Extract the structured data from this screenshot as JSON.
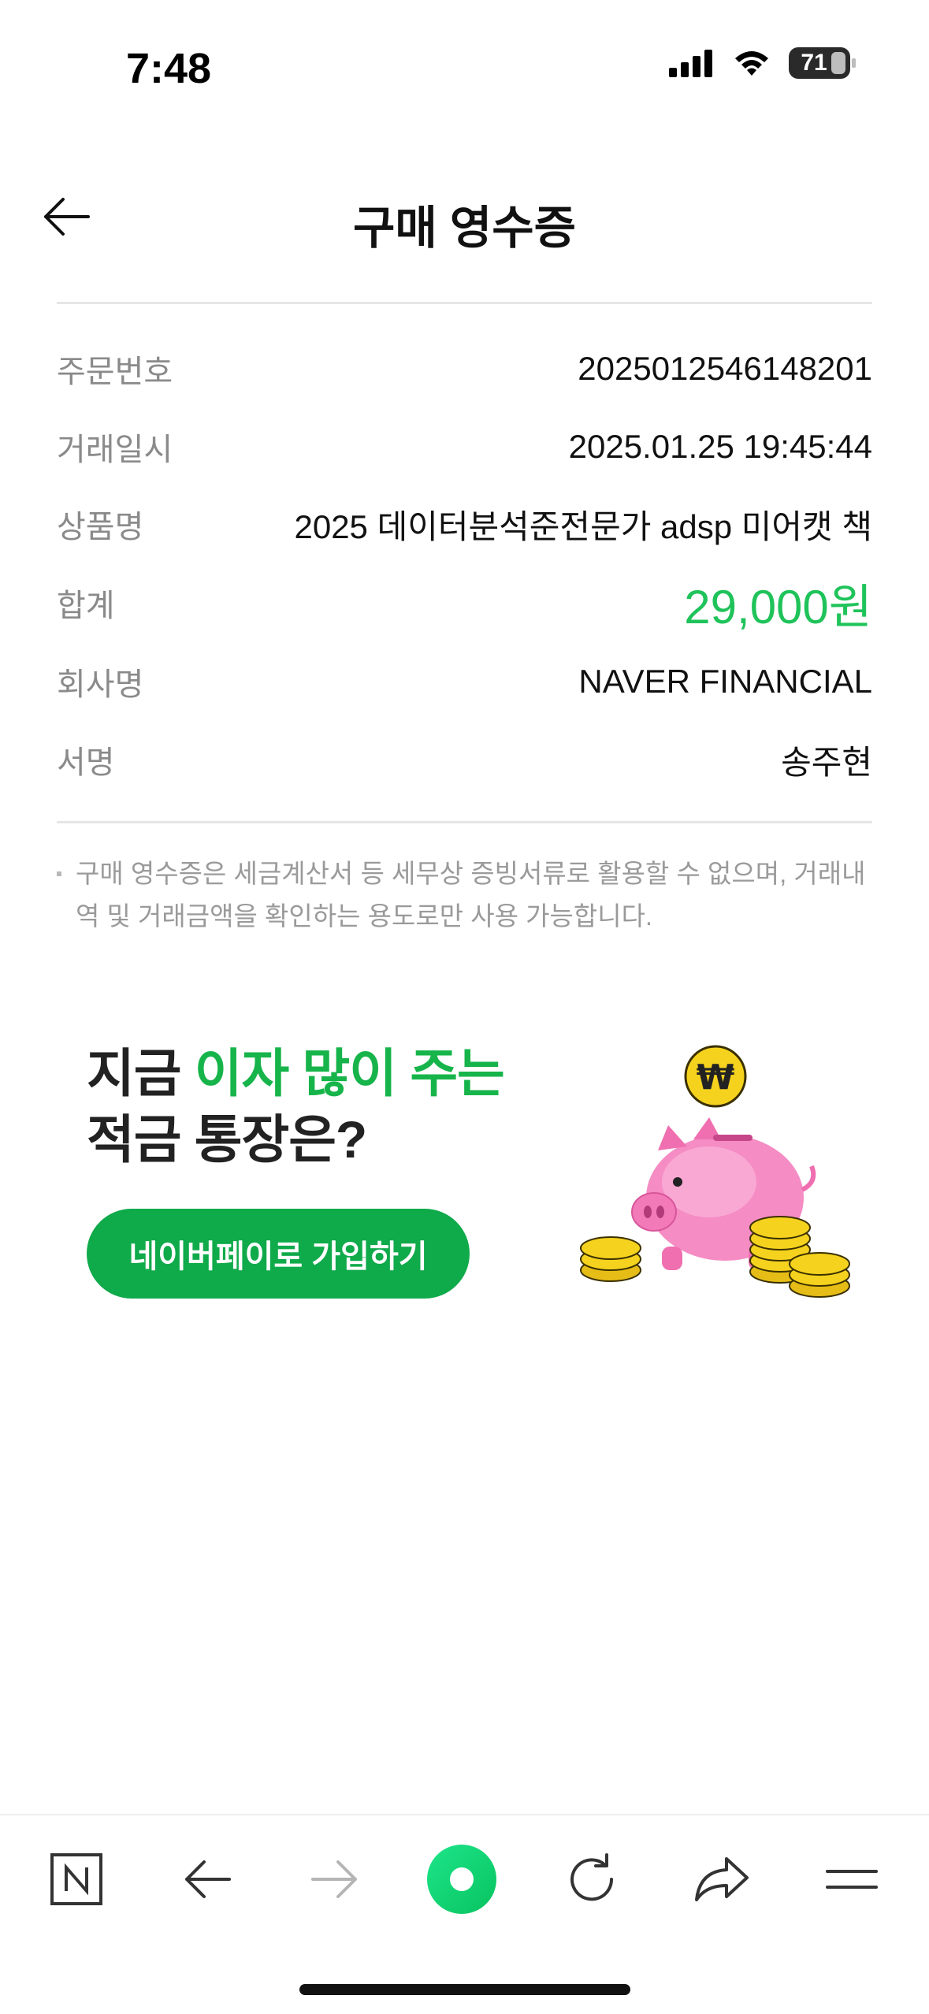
{
  "status_bar": {
    "time": "7:48",
    "battery": "71"
  },
  "header": {
    "title": "구매 영수증"
  },
  "receipt": {
    "rows": [
      {
        "label": "주문번호",
        "value": "2025012546148201"
      },
      {
        "label": "거래일시",
        "value": "2025.01.25 19:45:44"
      },
      {
        "label": "상품명",
        "value": "2025 데이터분석준전문가 adsp 미어캣 책"
      },
      {
        "label": "합계",
        "value": "29,000원"
      },
      {
        "label": "회사명",
        "value": "NAVER FINANCIAL"
      },
      {
        "label": "서명",
        "value": "송주현"
      }
    ],
    "notice": "구매 영수증은 세금계산서 등 세무상 증빙서류로 활용할 수 없으며, 거래내역 및 거래금액을 확인하는 용도로만 사용 가능합니다."
  },
  "banner": {
    "line1_plain": "지금 ",
    "line1_highlight": "이자 많이 주는",
    "line2": "적금 통장은?",
    "button_label": "네이버페이로 가입하기",
    "coin_symbol": "₩",
    "accent_color": "#16b44a"
  },
  "toolbar": {
    "items": [
      "naver-home-icon",
      "back-arrow-icon",
      "forward-arrow-icon",
      "green-dot-icon",
      "reload-icon",
      "share-icon",
      "menu-icon"
    ]
  },
  "colors": {
    "total": "#1fc35a",
    "button": "#0faa4a"
  }
}
